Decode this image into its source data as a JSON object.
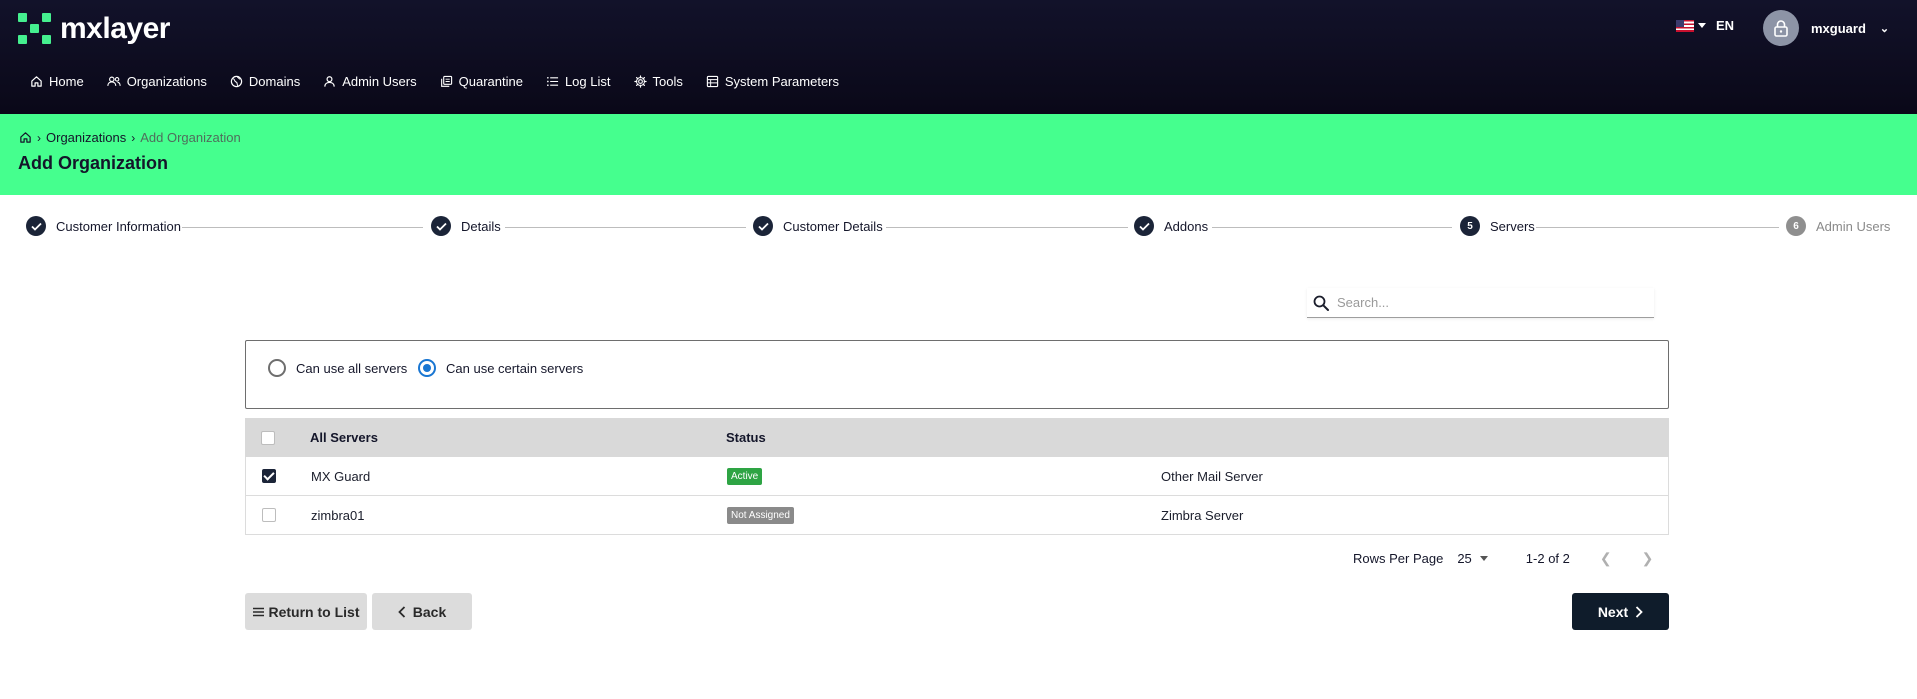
{
  "brand": {
    "name": "mxlayer",
    "color": "#45f08f"
  },
  "header": {
    "language": "EN",
    "username": "mxguard",
    "flag_icon": "us-flag-icon",
    "avatar_icon": "lock-icon"
  },
  "nav": [
    {
      "label": "Home",
      "icon": "home-icon"
    },
    {
      "label": "Organizations",
      "icon": "users-icon"
    },
    {
      "label": "Domains",
      "icon": "globe-icon"
    },
    {
      "label": "Admin Users",
      "icon": "user-icon"
    },
    {
      "label": "Quarantine",
      "icon": "quarantine-icon"
    },
    {
      "label": "Log List",
      "icon": "list-icon"
    },
    {
      "label": "Tools",
      "icon": "gear-icon"
    },
    {
      "label": "System Parameters",
      "icon": "table-icon"
    }
  ],
  "breadcrumb": {
    "items": [
      "Organizations",
      "Add Organization"
    ]
  },
  "page": {
    "title": "Add Organization"
  },
  "steps": [
    {
      "label": "Customer Information",
      "state": "done"
    },
    {
      "label": "Details",
      "state": "done"
    },
    {
      "label": "Customer Details",
      "state": "done"
    },
    {
      "label": "Addons",
      "state": "done"
    },
    {
      "label": "Servers",
      "state": "current",
      "number": "5"
    },
    {
      "label": "Admin Users",
      "state": "pending",
      "number": "6"
    }
  ],
  "search": {
    "placeholder": "Search..."
  },
  "server_mode": {
    "options": [
      "Can use all servers",
      "Can use certain servers"
    ],
    "selected": "Can use certain servers"
  },
  "table": {
    "headers": {
      "name": "All Servers",
      "status": "Status"
    },
    "rows": [
      {
        "name": "MX Guard",
        "status": "Active",
        "type": "Other Mail Server",
        "checked": true
      },
      {
        "name": "zimbra01",
        "status": "Not Assigned",
        "type": "Zimbra Server",
        "checked": false
      }
    ]
  },
  "pagination": {
    "rows_per_page_label": "Rows Per Page",
    "rows_per_page": "25",
    "range": "1-2 of 2"
  },
  "actions": {
    "return_label": "Return to List",
    "back_label": "Back",
    "next_label": "Next"
  },
  "colors": {
    "hero": "#45ff8e",
    "dark": "#0f1c2b",
    "active_badge": "#2ea444",
    "radio_selected": "#1976d2"
  }
}
